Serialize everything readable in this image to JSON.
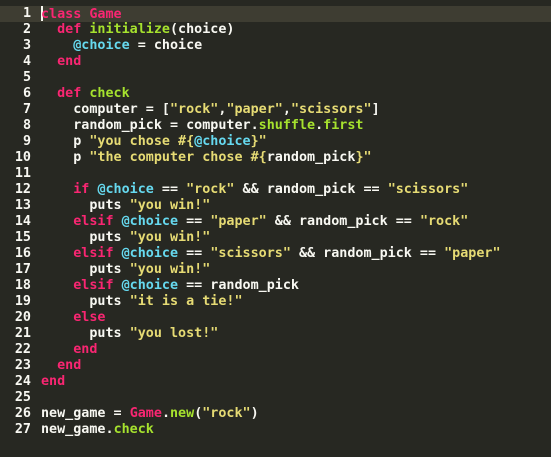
{
  "editor": {
    "theme_colors": {
      "background": "#272822",
      "current_line": "#3e3d32",
      "keyword": "#f92672",
      "function": "#a6e22e",
      "instance_var": "#66d9ef",
      "string": "#e6db74",
      "plain": "#f8f8f2"
    },
    "cursor_line": 1,
    "lines": [
      {
        "num": "1",
        "tokens": [
          [
            "kw",
            "class"
          ],
          [
            "txt",
            " "
          ],
          [
            "cls",
            "Game"
          ]
        ]
      },
      {
        "num": "2",
        "tokens": [
          [
            "txt",
            "  "
          ],
          [
            "kw",
            "def"
          ],
          [
            "txt",
            " "
          ],
          [
            "fn",
            "initialize"
          ],
          [
            "txt",
            "(choice)"
          ]
        ]
      },
      {
        "num": "3",
        "tokens": [
          [
            "txt",
            "    "
          ],
          [
            "ivar",
            "@choice"
          ],
          [
            "txt",
            " = choice"
          ]
        ]
      },
      {
        "num": "4",
        "tokens": [
          [
            "txt",
            "  "
          ],
          [
            "kw",
            "end"
          ]
        ]
      },
      {
        "num": "5",
        "tokens": []
      },
      {
        "num": "6",
        "tokens": [
          [
            "txt",
            "  "
          ],
          [
            "kw",
            "def"
          ],
          [
            "txt",
            " "
          ],
          [
            "fn",
            "check"
          ]
        ]
      },
      {
        "num": "7",
        "tokens": [
          [
            "txt",
            "    computer = ["
          ],
          [
            "str",
            "\"rock\""
          ],
          [
            "txt",
            ","
          ],
          [
            "str",
            "\"paper\""
          ],
          [
            "txt",
            ","
          ],
          [
            "str",
            "\"scissors\""
          ],
          [
            "txt",
            "]"
          ]
        ]
      },
      {
        "num": "8",
        "tokens": [
          [
            "txt",
            "    random_pick = computer."
          ],
          [
            "fn",
            "shuffle"
          ],
          [
            "txt",
            "."
          ],
          [
            "fn",
            "first"
          ]
        ]
      },
      {
        "num": "9",
        "tokens": [
          [
            "txt",
            "    p "
          ],
          [
            "str",
            "\"you chose #{"
          ],
          [
            "ivar",
            "@choice"
          ],
          [
            "str",
            "}\""
          ]
        ]
      },
      {
        "num": "10",
        "tokens": [
          [
            "txt",
            "    p "
          ],
          [
            "str",
            "\"the computer chose #{"
          ],
          [
            "txt",
            "random_pick"
          ],
          [
            "str",
            "}\""
          ]
        ]
      },
      {
        "num": "11",
        "tokens": []
      },
      {
        "num": "12",
        "tokens": [
          [
            "txt",
            "    "
          ],
          [
            "kw",
            "if"
          ],
          [
            "txt",
            " "
          ],
          [
            "ivar",
            "@choice"
          ],
          [
            "txt",
            " == "
          ],
          [
            "str",
            "\"rock\""
          ],
          [
            "txt",
            " && random_pick == "
          ],
          [
            "str",
            "\"scissors\""
          ]
        ]
      },
      {
        "num": "13",
        "tokens": [
          [
            "txt",
            "      puts "
          ],
          [
            "str",
            "\"you win!\""
          ]
        ]
      },
      {
        "num": "14",
        "tokens": [
          [
            "txt",
            "    "
          ],
          [
            "kw",
            "elsif"
          ],
          [
            "txt",
            " "
          ],
          [
            "ivar",
            "@choice"
          ],
          [
            "txt",
            " == "
          ],
          [
            "str",
            "\"paper\""
          ],
          [
            "txt",
            " && random_pick == "
          ],
          [
            "str",
            "\"rock\""
          ]
        ]
      },
      {
        "num": "15",
        "tokens": [
          [
            "txt",
            "      puts "
          ],
          [
            "str",
            "\"you win!\""
          ]
        ]
      },
      {
        "num": "16",
        "tokens": [
          [
            "txt",
            "    "
          ],
          [
            "kw",
            "elsif"
          ],
          [
            "txt",
            " "
          ],
          [
            "ivar",
            "@choice"
          ],
          [
            "txt",
            " == "
          ],
          [
            "str",
            "\"scissors\""
          ],
          [
            "txt",
            " && random_pick == "
          ],
          [
            "str",
            "\"paper\""
          ]
        ]
      },
      {
        "num": "17",
        "tokens": [
          [
            "txt",
            "      puts "
          ],
          [
            "str",
            "\"you win!\""
          ]
        ]
      },
      {
        "num": "18",
        "tokens": [
          [
            "txt",
            "    "
          ],
          [
            "kw",
            "elsif"
          ],
          [
            "txt",
            " "
          ],
          [
            "ivar",
            "@choice"
          ],
          [
            "txt",
            " == random_pick"
          ]
        ]
      },
      {
        "num": "19",
        "tokens": [
          [
            "txt",
            "      puts "
          ],
          [
            "str",
            "\"it is a tie!\""
          ]
        ]
      },
      {
        "num": "20",
        "tokens": [
          [
            "txt",
            "    "
          ],
          [
            "kw",
            "else"
          ]
        ]
      },
      {
        "num": "21",
        "tokens": [
          [
            "txt",
            "      puts "
          ],
          [
            "str",
            "\"you lost!\""
          ]
        ]
      },
      {
        "num": "22",
        "tokens": [
          [
            "txt",
            "    "
          ],
          [
            "kw",
            "end"
          ]
        ]
      },
      {
        "num": "23",
        "tokens": [
          [
            "txt",
            "  "
          ],
          [
            "kw",
            "end"
          ]
        ]
      },
      {
        "num": "24",
        "tokens": [
          [
            "kw",
            "end"
          ]
        ]
      },
      {
        "num": "25",
        "tokens": []
      },
      {
        "num": "26",
        "tokens": [
          [
            "txt",
            "new_game = "
          ],
          [
            "cls",
            "Game"
          ],
          [
            "txt",
            "."
          ],
          [
            "fn",
            "new"
          ],
          [
            "txt",
            "("
          ],
          [
            "str",
            "\"rock\""
          ],
          [
            "txt",
            ")"
          ]
        ]
      },
      {
        "num": "27",
        "tokens": [
          [
            "txt",
            "new_game."
          ],
          [
            "fn",
            "check"
          ]
        ]
      }
    ]
  }
}
